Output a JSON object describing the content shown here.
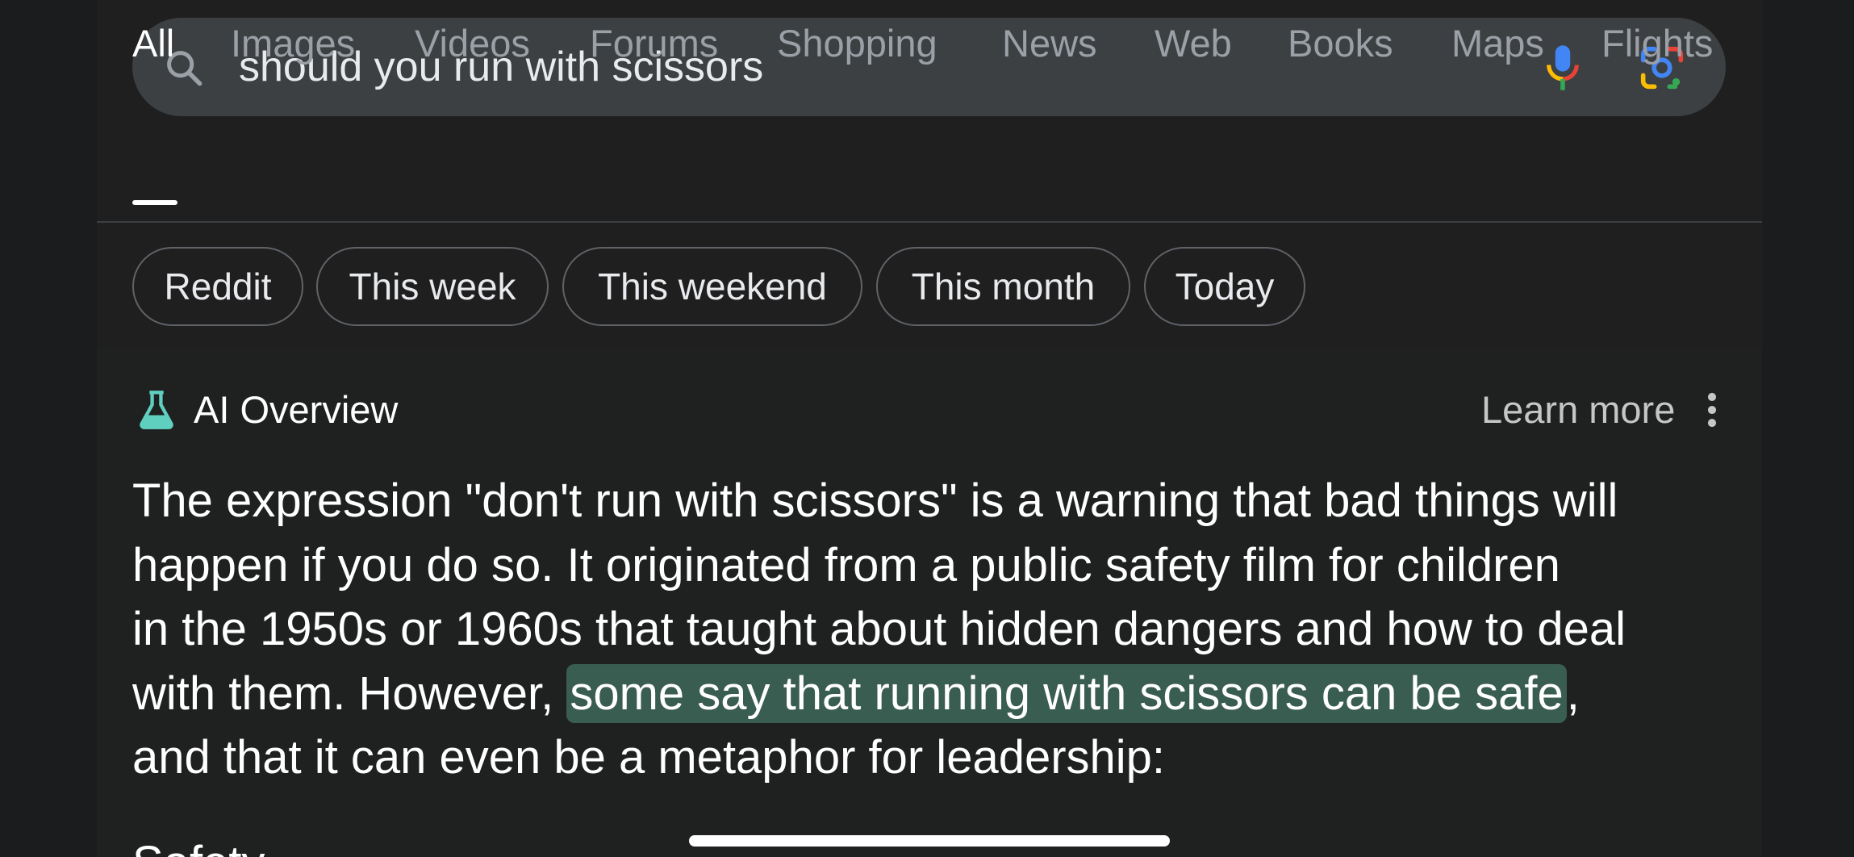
{
  "search": {
    "query": "should you run with scissors",
    "icons": [
      "search-icon",
      "mic-icon",
      "lens-icon"
    ]
  },
  "tabs": [
    {
      "label": "All",
      "active": true
    },
    {
      "label": "Images",
      "active": false
    },
    {
      "label": "Videos",
      "active": false
    },
    {
      "label": "Forums",
      "active": false
    },
    {
      "label": "Shopping",
      "active": false
    },
    {
      "label": "News",
      "active": false
    },
    {
      "label": "Web",
      "active": false
    },
    {
      "label": "Books",
      "active": false
    },
    {
      "label": "Maps",
      "active": false
    },
    {
      "label": "Flights",
      "active": false
    }
  ],
  "chips": [
    {
      "label": "Reddit"
    },
    {
      "label": "This week"
    },
    {
      "label": "This weekend"
    },
    {
      "label": "This month"
    },
    {
      "label": "Today"
    }
  ],
  "overview": {
    "title": "AI Overview",
    "learn_more": "Learn more",
    "lines": [
      "The expression \"don't run with scissors\" is a warning that bad things will",
      "happen if you do so. It originated from a public safety film for children",
      "in the 1950s or 1960s that taught about hidden dangers and how to deal"
    ],
    "line4_before": "with them. However, ",
    "line4_highlight": "some say that running with scissors can be safe",
    "line4_after": ",",
    "line5": "and that it can even be a metaphor for leadership:",
    "next_heading": "Safety"
  },
  "colors": {
    "background": "#1f1f1f",
    "search_bar": "#3c4043",
    "highlight": "#3a5d51",
    "flask": "#5fd0c0"
  }
}
